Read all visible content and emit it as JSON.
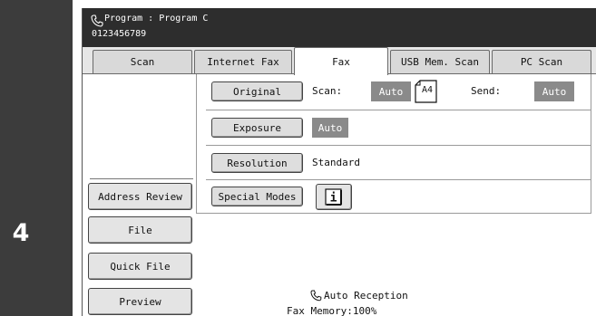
{
  "step": {
    "number": "4"
  },
  "header": {
    "title": "Program : Program C",
    "number": "0123456789"
  },
  "tabs": [
    {
      "label": "Scan"
    },
    {
      "label": "Internet Fax"
    },
    {
      "label": "Fax"
    },
    {
      "label": "USB Mem. Scan"
    },
    {
      "label": "PC Scan"
    }
  ],
  "sidebar": {
    "address_review": "Address Review",
    "file": "File",
    "quick_file": "Quick File",
    "preview": "Preview"
  },
  "settings": {
    "original_label": "Original",
    "scan_label": "Scan:",
    "scan_value": "Auto",
    "paper_size": "A4",
    "send_label": "Send:",
    "send_value": "Auto",
    "exposure_label": "Exposure",
    "exposure_value": "Auto",
    "resolution_label": "Resolution",
    "resolution_value": "Standard",
    "special_modes_label": "Special Modes",
    "info_glyph": "i"
  },
  "status": {
    "reception": "Auto Reception",
    "memory": "Fax Memory:100%"
  },
  "colors": {
    "title_bar": "#2d2d2d",
    "badge": "#8a8a8a",
    "step_bar": "#3c3c3c"
  }
}
